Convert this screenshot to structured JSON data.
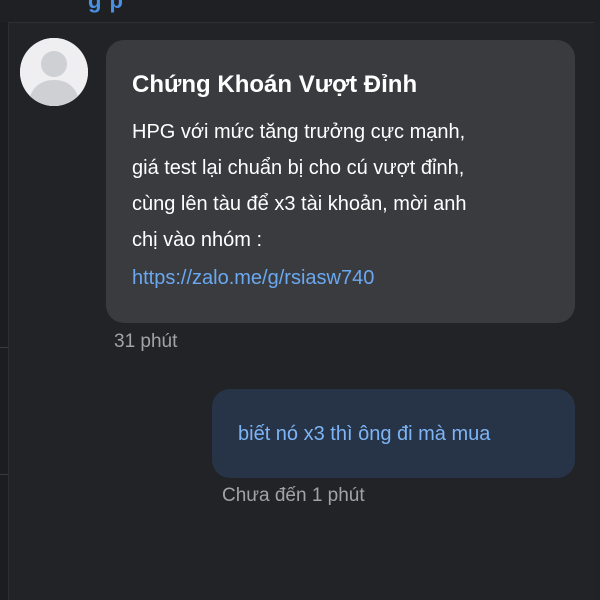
{
  "header": {
    "title_fragment": "g                    p"
  },
  "incoming_message": {
    "sender": "Chứng Khoán Vượt Đỉnh",
    "lines": [
      "HPG với mức tăng trưởng cực mạnh,",
      "giá test lại chuẩn bị cho cú vượt đỉnh,",
      "cùng lên tàu để x3 tài khoản, mời anh",
      "chị vào nhóm :"
    ],
    "link": "https://zalo.me/g/rsiasw740",
    "time": "31 phút"
  },
  "outgoing_message": {
    "text": "biết nó x3 thì ông đi mà mua",
    "time": "Chưa đến 1 phút"
  },
  "colors": {
    "background": "#222326",
    "incoming_bubble": "#3a3b3f",
    "outgoing_bubble": "#273447",
    "link": "#6aa8f0",
    "outgoing_text": "#7db4f5",
    "timestamp": "#a0a3a8"
  }
}
